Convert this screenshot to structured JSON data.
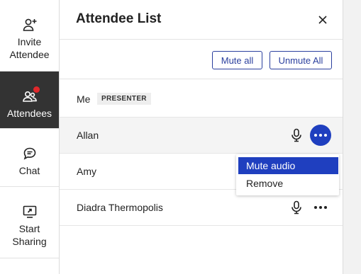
{
  "rail": {
    "items": [
      {
        "label_line1": "Invite",
        "label_line2": "Attendee",
        "icon": "add-user-icon"
      },
      {
        "label": "Attendees",
        "icon": "attendees-icon",
        "has_badge": true,
        "active": true
      },
      {
        "label": "Chat",
        "icon": "chat-icon"
      },
      {
        "label_line1": "Start",
        "label_line2": "Sharing",
        "icon": "share-screen-icon"
      }
    ]
  },
  "panel": {
    "title": "Attendee List",
    "close_icon": "close-icon"
  },
  "toolbar": {
    "mute_all_label": "Mute all",
    "unmute_all_label": "Unmute All"
  },
  "attendees": [
    {
      "name": "Me",
      "role_badge": "PRESENTER"
    },
    {
      "name": "Allan",
      "has_mic": true,
      "menu_open": true
    },
    {
      "name": "Amy"
    },
    {
      "name": "Diadra Thermopolis",
      "has_mic": true
    }
  ],
  "context_menu": {
    "items": [
      "Mute audio",
      "Remove"
    ],
    "selected": "Mute audio"
  },
  "colors": {
    "accent": "#1f3fbf",
    "rail_active_bg": "#333333",
    "badge": "#e0282b"
  }
}
